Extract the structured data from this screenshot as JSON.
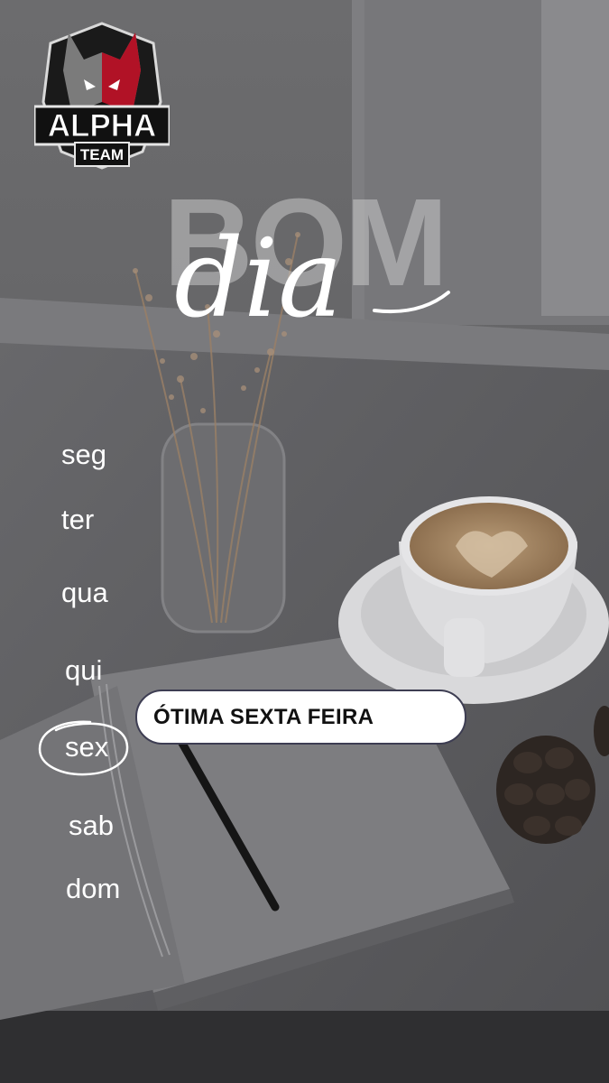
{
  "logo": {
    "line1": "ALPHA",
    "line2": "TEAM"
  },
  "headline": {
    "word1": "BOM",
    "word2": "dia"
  },
  "weekdays": [
    "seg",
    "ter",
    "qua",
    "qui",
    "sex",
    "sab",
    "dom"
  ],
  "selected_day": "sex",
  "message": "ÓTIMA SEXTA FEIRA",
  "colors": {
    "accent_red": "#c8102e",
    "overlay": "#3a3a3d",
    "bubble": "#ffffff"
  }
}
